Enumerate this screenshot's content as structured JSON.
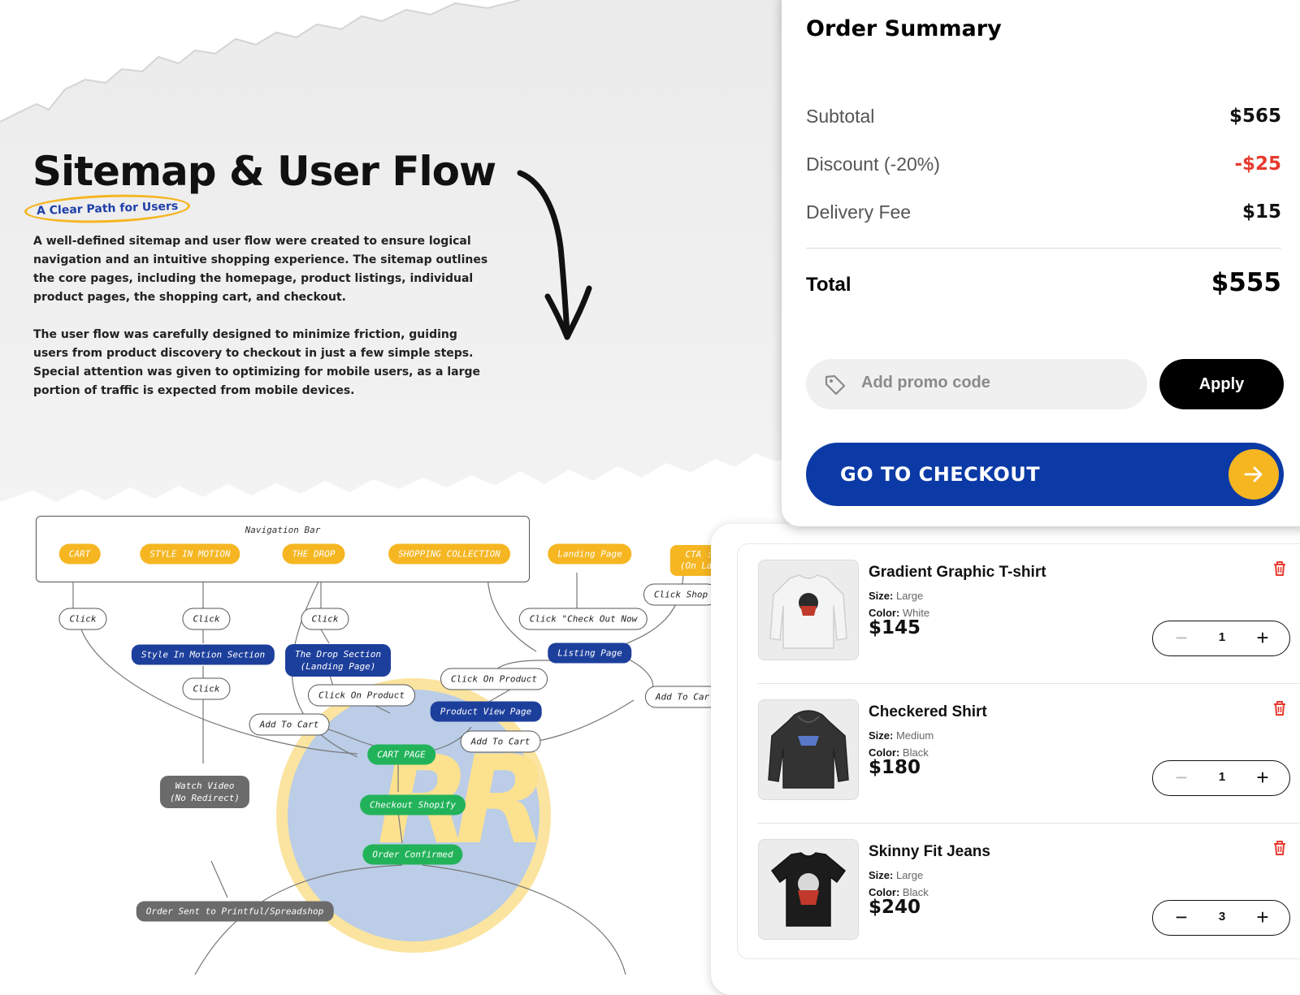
{
  "hero": {
    "title": "Sitemap & User Flow",
    "subtitle": "A Clear Path for Users",
    "paragraph1": "A well-defined sitemap and user flow were created to ensure logical navigation and an intuitive shopping experience. The sitemap outlines the core pages, including the homepage, product listings, individual product pages, the shopping cart, and checkout.",
    "paragraph2": "The user flow was carefully designed to minimize friction, guiding users from product discovery to checkout in just a few simple steps. Special attention was given to optimizing for mobile users, as a large portion of traffic is expected from mobile devices."
  },
  "flow": {
    "nav_title": "Navigation Bar",
    "nav_items": [
      "CART",
      "STYLE IN MOTION",
      "THE DROP",
      "SHOPPING COLLECTION"
    ],
    "landing_page": "Landing Page",
    "cta_line1": "CTA :",
    "cta_line2": "(On Lan",
    "click": "Click",
    "click_shop": "Click Shop",
    "click_check_out_now": "Click \"Check Out Now",
    "style_in_motion_section": "Style In Motion Section",
    "drop_section_line1": "The Drop Section",
    "drop_section_line2": "(Landing Page)",
    "listing_page": "Listing Page",
    "click_on_product": "Click On Product",
    "add_to_cart": "Add To Cart",
    "add_to_cart_partial": "Add To Car",
    "product_view_page": "Product View Page",
    "cart_page": "CART PAGE",
    "checkout_shopify": "Checkout Shopify",
    "order_confirmed": "Order Confirmed",
    "watch_video_line1": "Watch Video",
    "watch_video_line2": "(No Redirect)",
    "order_sent": "Order Sent to Printful/Spreadshop",
    "logo_text": "RR",
    "logo_registered": "®"
  },
  "summary": {
    "title": "Order Summary",
    "subtotal_label": "Subtotal",
    "subtotal_value": "$565",
    "discount_label": "Discount (-20%)",
    "discount_value": "-$25",
    "delivery_label": "Delivery Fee",
    "delivery_value": "$15",
    "total_label": "Total",
    "total_value": "$555",
    "promo_placeholder": "Add promo code",
    "apply_label": "Apply",
    "checkout_label": "GO TO CHECKOUT",
    "colors": {
      "accent_blue": "#0b3aa6",
      "accent_yellow": "#f5b622",
      "discount_red": "#e63a2e"
    }
  },
  "cart": {
    "size_label": "Size:",
    "color_label": "Color:",
    "items": [
      {
        "name": "Gradient Graphic T-shirt",
        "size": "Large",
        "color": "White",
        "price": "$145",
        "qty": "1",
        "thumb_icon": "white-sweatshirt-image"
      },
      {
        "name": "Checkered Shirt",
        "size": "Medium",
        "color": "Black",
        "price": "$180",
        "qty": "1",
        "thumb_icon": "black-hoodie-image"
      },
      {
        "name": "Skinny Fit Jeans",
        "size": "Large",
        "color": "Black",
        "price": "$240",
        "qty": "3",
        "thumb_icon": "black-tshirt-image"
      }
    ],
    "minus_glyph": "−",
    "plus_glyph": "+"
  }
}
